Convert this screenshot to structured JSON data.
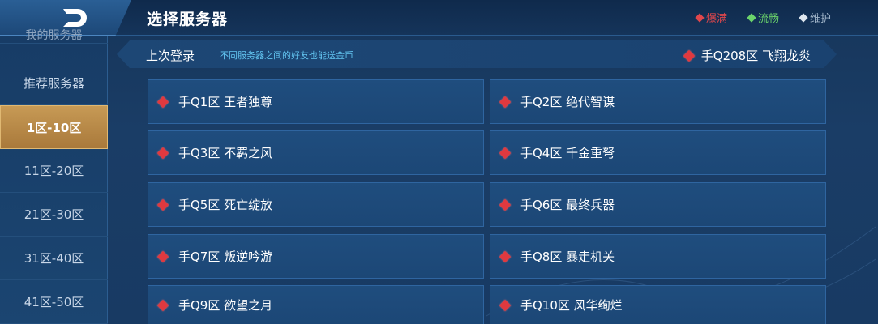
{
  "header": {
    "title": "选择服务器",
    "legend": [
      {
        "label": "爆满",
        "color": "#e0474c"
      },
      {
        "label": "流畅",
        "color": "#6bd46b"
      },
      {
        "label": "维护",
        "color": "#dfe7ef"
      }
    ]
  },
  "sidebar": {
    "partial_item": "我的服务器",
    "items": [
      {
        "label": "推荐服务器"
      },
      {
        "label": "1区-10区"
      },
      {
        "label": "11区-20区"
      },
      {
        "label": "21区-30区"
      },
      {
        "label": "31区-40区"
      },
      {
        "label": "41区-50区"
      }
    ]
  },
  "last_login": {
    "label": "上次登录",
    "note": "不同服务器之间的好友也能送金币",
    "server": "手Q208区 飞翔龙炎"
  },
  "servers": [
    {
      "name": "手Q1区 王者独尊"
    },
    {
      "name": "手Q2区 绝代智谋"
    },
    {
      "name": "手Q3区 不羁之风"
    },
    {
      "name": "手Q4区 千金重弩"
    },
    {
      "name": "手Q5区 死亡绽放"
    },
    {
      "name": "手Q6区 最终兵器"
    },
    {
      "name": "手Q7区 叛逆吟游"
    },
    {
      "name": "手Q8区 暴走机关"
    },
    {
      "name": "手Q9区 欲望之月"
    },
    {
      "name": "手Q10区 风华绚烂"
    }
  ]
}
